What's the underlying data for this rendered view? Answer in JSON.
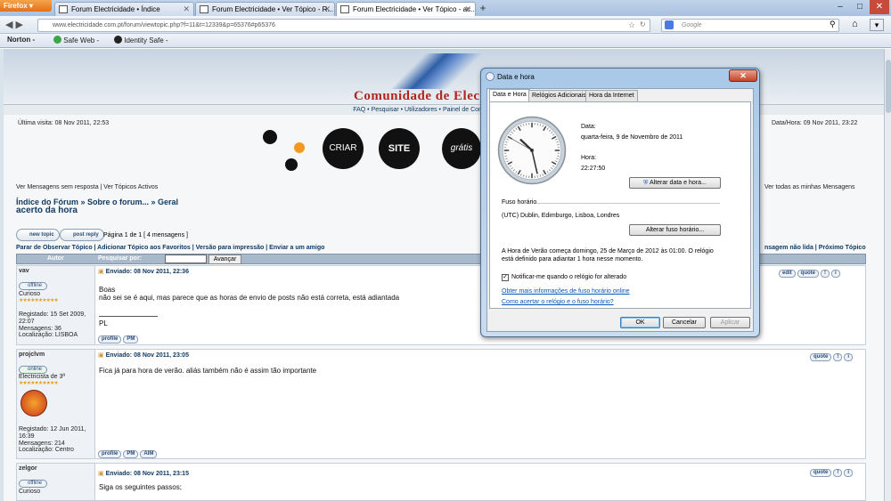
{
  "browser": {
    "app_button": "Firefox",
    "tabs": [
      {
        "title": "Forum Electricidade • Índice"
      },
      {
        "title": "Forum Electricidade • Ver Tópico - R..."
      },
      {
        "title": "Forum Electricidade • Ver Tópico - ac..."
      }
    ],
    "new_tab": "+",
    "url": "www.electricidade.com.pt/forum/viewtopic.php?f=11&t=12339&p=65376#p65376",
    "search_placeholder": "Google",
    "toolbar": {
      "norton": "Norton -",
      "safe_web": "Safe Web -",
      "identity_safe": "Identity Safe -"
    }
  },
  "forum": {
    "logo_text": "Comunidade de Elec",
    "menu": "FAQ  •  Pesquisar  •  Utilizadores  •  Painel de Controlo do Utilizador  •",
    "last_visit": "Última visita: 08 Nov 2011, 22:53",
    "datetime": "Data/Hora: 09 Nov 2011, 23:22",
    "ad": {
      "word1": "CRIAR",
      "word2": "SITE",
      "word3": "grátis"
    },
    "left_links": "Ver Mensagens sem resposta  |  Ver Tópicos Activos",
    "right_links": "Ver todas as minhas Mensagens",
    "breadcrumb": "Índice do Fórum » Sobre o forum... » Geral",
    "topic_title": "acerto da hora",
    "newtopic_label": "new topic",
    "postreply_label": "post reply",
    "page_count": "Página 1 de 1   [ 4 mensagens ]",
    "options": "Parar de Observar Tópico | Adicionar Tópico aos Favoritos | Versão para impressão | Enviar a um amigo",
    "options_right": "nsagem não lida  |  Próximo Tópico",
    "header_author": "Autor",
    "search_label": "Pesquisar por:",
    "search_button": "Avançar",
    "posts": [
      {
        "author": "vav",
        "status": "offline",
        "rank": "Curioso",
        "stars": "★★★★★★★★★★",
        "info": [
          "Registado: 15 Set 2009, 22:07",
          "Mensagens: 36",
          "Localização: LISBOA"
        ],
        "header": "Enviado: 08 Nov 2011, 22:36",
        "lines": [
          "Boas",
          "não sei se é aqui, mas parece que as horas de envio de posts não está correta, está adiantada",
          "PL"
        ],
        "buttons": [
          "profile",
          "PM"
        ],
        "actions": [
          "edit",
          "quote",
          "!",
          "i"
        ]
      },
      {
        "author": "projclvm",
        "status": "online",
        "rank": "Electricista de 3ª",
        "stars": "★★★★★★★★★★",
        "info": [
          "Registado: 12 Jun 2011, 16:39",
          "Mensagens: 214",
          "Localização: Centro"
        ],
        "header": "Enviado: 08 Nov 2011, 23:05",
        "lines": [
          "Fica já para hora de verão. aliás também não é assim tão importante"
        ],
        "buttons": [
          "profile",
          "PM",
          "AIM"
        ],
        "actions": [
          "quote",
          "!",
          "i"
        ]
      },
      {
        "author": "zelgor",
        "status": "offline",
        "rank": "Curioso",
        "header": "Enviado: 08 Nov 2011, 23:15",
        "lines": [
          "Siga os seguintes passos;"
        ],
        "actions": [
          "quote",
          "!",
          "i"
        ]
      }
    ]
  },
  "dialog": {
    "title": "Data e hora",
    "close": "✕",
    "tabs": [
      "Data e Hora",
      "Relógios Adicionais",
      "Hora da Internet"
    ],
    "date_label": "Data:",
    "date_value": "quarta-feira, 9 de Novembro de 2011",
    "time_label": "Hora:",
    "time_value": "22:27:50",
    "change_datetime_button": "Alterar data e hora...",
    "timezone_label": "Fuso horário",
    "timezone_value": "(UTC) Dublin, Edimburgo, Lisboa, Londres",
    "change_timezone_button": "Alterar fuso horário...",
    "dst_text_1": "A Hora de Verão começa domingo, 25 de Março de 2012 às 01:00. O relógio",
    "dst_text_2": "está definido para adiantar 1 hora nesse momento.",
    "notify_label": "Notificar-me quando o relógio for alterado",
    "notify_checked": true,
    "link_timezone_info": "Obter mais informações de fuso horário online",
    "link_how_to_set": "Como acertar o relógio e o fuso horário?",
    "ok": "OK",
    "cancel": "Cancelar",
    "apply": "Aplicar",
    "clock": {
      "hours": 22,
      "minutes": 27,
      "seconds": 50
    }
  }
}
